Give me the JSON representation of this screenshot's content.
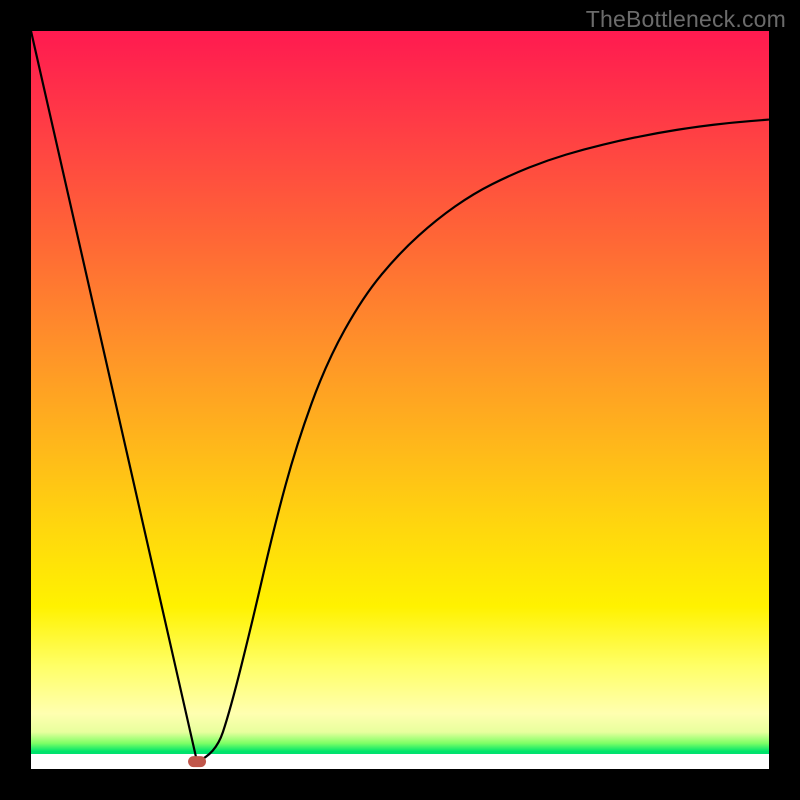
{
  "watermark": "TheBottleneck.com",
  "chart_data": {
    "type": "line",
    "title": "",
    "xlabel": "",
    "ylabel": "",
    "xlim": [
      0,
      100
    ],
    "ylim": [
      0,
      100
    ],
    "grid": false,
    "legend": false,
    "series": [
      {
        "name": "bottleneck-curve",
        "x": [
          0,
          5,
          10,
          15,
          20,
          22.5,
          25,
          27,
          30,
          33,
          36,
          40,
          45,
          50,
          55,
          60,
          65,
          70,
          75,
          80,
          85,
          90,
          95,
          100
        ],
        "y": [
          100,
          78,
          56,
          34,
          12,
          1,
          2,
          8,
          20,
          33,
          44,
          55,
          64,
          70,
          74.5,
          78,
          80.5,
          82.5,
          84,
          85.2,
          86.2,
          87,
          87.6,
          88
        ]
      }
    ],
    "marker": {
      "x": 22.5,
      "y": 1,
      "shape": "pill",
      "color": "#c0564a"
    },
    "background_gradient": {
      "orientation": "vertical",
      "stops": [
        {
          "pos": 0.0,
          "color": "#ff1a50"
        },
        {
          "pos": 0.28,
          "color": "#ff6636"
        },
        {
          "pos": 0.55,
          "color": "#ffb41c"
        },
        {
          "pos": 0.78,
          "color": "#fff200"
        },
        {
          "pos": 0.93,
          "color": "#ffffb0"
        },
        {
          "pos": 0.975,
          "color": "#00e56a"
        },
        {
          "pos": 1.0,
          "color": "#ffffff"
        }
      ]
    }
  }
}
